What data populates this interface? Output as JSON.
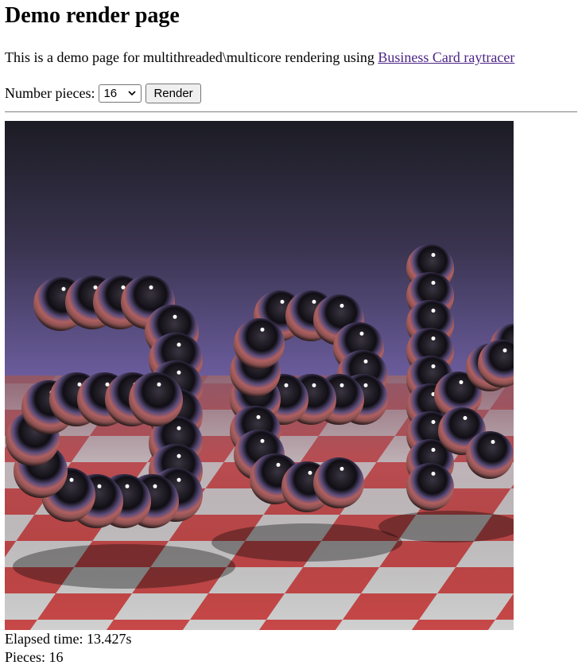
{
  "page": {
    "title": "Demo render page",
    "intro_text": "This is a demo page for multithreaded\\multicore rendering using ",
    "intro_link": "Business Card raytracer"
  },
  "controls": {
    "pieces_label": "Number pieces:",
    "pieces_value": "16",
    "render_label": "Render"
  },
  "result": {
    "elapsed_label": "Elapsed time:",
    "elapsed_value": "13.427s",
    "pieces_label": "Pieces:",
    "pieces_value": "16"
  },
  "colors": {
    "link": "#4b2385",
    "sky_top": "#1c1c24",
    "sky_horizon": "#9684d8",
    "floor_red": "#c84848",
    "floor_white": "#d0d0d0"
  },
  "icons": {
    "dropdown": "chevron-down-icon"
  }
}
